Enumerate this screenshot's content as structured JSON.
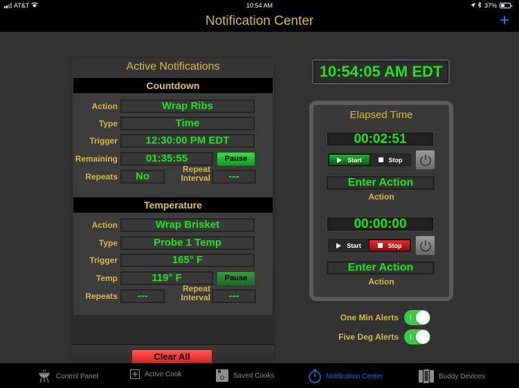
{
  "status_bar": {
    "carrier": "AT&T",
    "time": "10:54 AM",
    "battery": "37%"
  },
  "nav": {
    "title": "Notification Center",
    "add_label": "+"
  },
  "active_notifications": {
    "title": "Active Notifications",
    "countdown": {
      "header": "Countdown",
      "labels": {
        "action": "Action",
        "type": "Type",
        "trigger": "Trigger",
        "remaining": "Remaining",
        "repeats": "Repeats",
        "repeat_interval_1": "Repeat",
        "repeat_interval_2": "Interval"
      },
      "action": "Wrap Ribs",
      "type": "Time",
      "trigger": "12:30:00 PM EDT",
      "remaining": "01:35:55",
      "repeats": "No",
      "repeat_interval": "---",
      "pause_label": "Pause"
    },
    "temperature": {
      "header": "Temperature",
      "labels": {
        "action": "Action",
        "type": "Type",
        "trigger": "Trigger",
        "temp": "Temp",
        "repeats": "Repeats",
        "repeat_interval_1": "Repeat",
        "repeat_interval_2": "Interval"
      },
      "action": "Wrap Brisket",
      "type": "Probe 1 Temp",
      "trigger": "165° F",
      "temp": "119° F",
      "repeats": "---",
      "repeat_interval": "---",
      "pause_label": "Pause"
    },
    "clear_all_label": "Clear All"
  },
  "clock": "10:54:05 AM EDT",
  "elapsed_time": {
    "title": "Elapsed Time",
    "timers": [
      {
        "value": "00:02:51",
        "start_label": "Start",
        "stop_label": "Stop",
        "state": "running",
        "action_value": "Enter Action",
        "action_label": "Action"
      },
      {
        "value": "00:00:00",
        "start_label": "Start",
        "stop_label": "Stop",
        "state": "stopped",
        "action_value": "Enter Action",
        "action_label": "Action"
      }
    ]
  },
  "toggles": [
    {
      "label": "One Min Alerts",
      "on": true
    },
    {
      "label": "Five Deg Alerts",
      "on": true
    }
  ],
  "tabs": [
    {
      "label": "Control Panel",
      "icon": "grill-icon",
      "active": false
    },
    {
      "label": "Active Cook",
      "icon": "plus-square-icon",
      "active": false
    },
    {
      "label": "Saved Cooks",
      "icon": "floppy-disk-icon",
      "active": false
    },
    {
      "label": "Notification Center",
      "icon": "stopwatch-icon",
      "active": true
    },
    {
      "label": "Buddy Devices",
      "icon": "devices-icon",
      "active": false
    }
  ],
  "colors": {
    "accent_gold": "#d8b84a",
    "value_green": "#22e022",
    "tab_active_blue": "#1a6ee0",
    "background": "#333233"
  }
}
